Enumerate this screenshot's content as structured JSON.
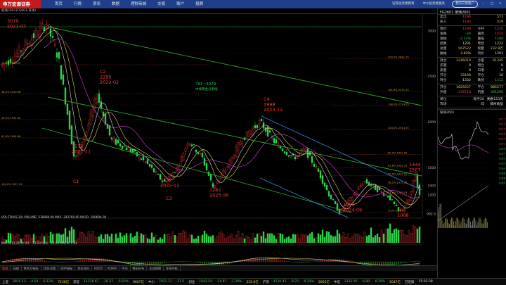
{
  "app": {
    "logo": "申万宏源证券",
    "menu": [
      "首页",
      "行情",
      "资讯",
      "数据",
      "理财商城",
      "交易",
      "账户",
      "投顾"
    ],
    "top_links": [
      "证券投资者教育",
      "中小投资者服务"
    ],
    "login_button": "我的交易账户"
  },
  "symbol_bar": "玻璃2601(FG601,日线)",
  "chart_data": {
    "type": "candlestick",
    "main_annotations": [
      {
        "text": "3079",
        "text2": "2021-07",
        "price": 3079
      },
      {
        "text": "C2",
        "text2": "2295",
        "text3": "2022-02",
        "price": 2295
      },
      {
        "text": "1572",
        "text2": "2021-11",
        "text3": "C1",
        "price": 1572
      },
      {
        "text": "1332",
        "text2": "2022-11",
        "text3": "C3",
        "price": 1332
      },
      {
        "text": "1282",
        "text2": "2023-06",
        "price": 1282
      },
      {
        "text": "C4",
        "text2": "1998",
        "text3": "2023-12",
        "price": 1998
      },
      {
        "text": "1004",
        "text2": "2024-09",
        "price": 1004
      },
      {
        "text": "1008",
        "price": 1008
      },
      {
        "text": "1444",
        "text2": "2507",
        "price": 1444
      }
    ],
    "channel_label": [
      "791~3079",
      "中线黄金分割线"
    ],
    "fib_levels": [
      {
        "label": "200.0%  2691.75",
        "price": 2691.75
      },
      {
        "label": "161.8%  2331.15",
        "price": 2331.15
      },
      {
        "label": "138.2%  2174.55",
        "price": 2174.55
      },
      {
        "label": "100.0%  1913.74",
        "price": 1913.74
      },
      {
        "label": "80.9%  1641.55",
        "price": 1641.55
      },
      {
        "label": "61.8%  1502.15",
        "price": 1502.15
      },
      {
        "label": "50.0%  1410.50",
        "price": 1410.5
      },
      {
        "label": "38.2%  1317.35",
        "price": 1317.35
      },
      {
        "label": "23.6%  1203.03",
        "price": 1203.03
      },
      {
        "label": "0.0%  1008.00",
        "price": 1008
      }
    ],
    "left_fib_levels": [
      "23.6%  2530.02",
      "38.2%  2250.98",
      "50.0%  1931.65",
      "61.8%  1844.46",
      "100.0%  1227.34"
    ],
    "price_axis": [
      "3000",
      "2500",
      "2000",
      "1500",
      "1300",
      "1200",
      "992.5"
    ],
    "volume_label": "VOL-TDX(5,10) VOLUME: 518480.00  MA5: 343760.00  MA10: 360694.00",
    "macd_label": "MACD(12,26,9) DIF: -13.93  DEA: -16.24  MACD: 4.62"
  },
  "sub_tabs": [
    "管理",
    "冠理",
    "MACD指标",
    "DDE决策",
    "BOP指标",
    "资金流向",
    "RSI55",
    "KDWR",
    "平均",
    "筹码分布",
    "全部周期",
    "年线中轨"
  ],
  "quote_panel": {
    "title": "FG2601 玻璃2601",
    "rows1": [
      {
        "l": "卖出",
        "v1": "1196",
        "v1c": "red",
        "l2": "",
        "v2": "571",
        "v2c": "yellow"
      },
      {
        "l": "买入",
        "v1": "1195",
        "v1c": "red",
        "l2": "",
        "v2": "519",
        "v2c": "yellow"
      }
    ],
    "rows2": [
      {
        "l": "现价",
        "v1": "1196",
        "v1c": "red",
        "l2": "今开",
        "v2": "1220",
        "v2c": "red"
      },
      {
        "l": "涨跌",
        "v1": "-26",
        "v1c": "green",
        "l2": "最高",
        "v2": "1224",
        "v2c": "red"
      },
      {
        "l": "涨幅",
        "v1": "-2.13%",
        "v1c": "green",
        "l2": "最低",
        "v2": "1184",
        "v2c": "green"
      },
      {
        "l": "结算",
        "v1": "1201",
        "v1c": "white",
        "l2": "昨结",
        "v2": "1222",
        "v2c": "white"
      },
      {
        "l": "总量",
        "v1": "567522",
        "v1c": "yellow",
        "l2": "现量",
        "v2": "232.9万",
        "v2c": "yellow"
      },
      {
        "l": "振幅",
        "v1": "3.03%",
        "v1c": "white",
        "l2": "均价",
        "v2": "1201",
        "v2c": "white"
      }
    ],
    "rows3": [
      {
        "l": "持仓",
        "v1": "2246019",
        "v1c": "yellow",
        "l2": "仓差",
        "v2": "61345",
        "v2c": "yellow"
      },
      {
        "l": "买量",
        "v1": "0",
        "v1c": "white",
        "l2": "增仓",
        "v2": "0",
        "v2c": "white"
      },
      {
        "l": "卖量",
        "v1": "0",
        "v1c": "white",
        "l2": "日增",
        "v2": "0",
        "v2c": "white"
      },
      {
        "l": "开仓",
        "v1": "33168",
        "v1c": "yellow",
        "l2": "平仓",
        "v2": "28",
        "v2c": "yellow"
      },
      {
        "l": "持仓",
        "v1": "1332",
        "v1c": "white",
        "l2": "跌停",
        "v2": "1112",
        "v2c": "green"
      }
    ],
    "rows4": [
      {
        "l": "开仓",
        "v1": "1829257",
        "v1c": "yellow",
        "l2": "平仓",
        "v2": "885577",
        "v2c": "yellow"
      },
      {
        "l": "外盘",
        "v1": "476718",
        "v1c": "red",
        "l2": "内盘",
        "v2": "491296",
        "v2c": "green"
      }
    ],
    "rows5": [
      {
        "l": "单位",
        "v1": "",
        "v1c": "white",
        "l2": "每手20吨",
        "v2": "剩余153天",
        "v2c": "white"
      },
      {
        "l": "市场",
        "v1": "",
        "v1c": "white",
        "l2": "",
        "v2": "郑州商品",
        "v2c": "white"
      }
    ],
    "mini_title": "玻璃2601",
    "mini_axis": [
      "1217",
      "1213",
      "1210",
      "1206",
      "1203",
      "1201",
      "1199",
      "1197",
      "1195",
      "1193",
      "1190",
      "1188",
      "1186",
      "1185"
    ]
  },
  "status_bar": [
    {
      "t": "上证",
      "c": "white"
    },
    {
      "t": "3835.13",
      "c": "green"
    },
    {
      "t": "-4.54",
      "c": "green"
    },
    {
      "t": "-0.12%",
      "c": "green"
    },
    {
      "t": "7136亿",
      "c": "yellow"
    },
    {
      "t": "深证",
      "c": "white"
    },
    {
      "t": "11128.67",
      "c": "green"
    },
    {
      "t": "-26.27",
      "c": "green"
    },
    {
      "t": "-0.20%",
      "c": "green"
    },
    {
      "t": "9607亿",
      "c": "yellow"
    },
    {
      "t": "中小",
      "c": "white"
    },
    {
      "t": "7021.11",
      "c": "green"
    },
    {
      "t": "-17.5",
      "c": "green"
    },
    {
      "t": "创业",
      "c": "white"
    },
    {
      "t": "1043.54",
      "c": "green"
    },
    {
      "t": "-14.87",
      "c": "green"
    },
    {
      "t": "-1.39%",
      "c": "green"
    },
    {
      "t": "333.8亿",
      "c": "yellow"
    },
    {
      "t": "沪深",
      "c": "white"
    },
    {
      "t": "4110.41",
      "c": "green"
    },
    {
      "t": "-9.70",
      "c": "green"
    },
    {
      "t": "-0.24%",
      "c": "green"
    },
    {
      "t": "3065亿",
      "c": "yellow"
    },
    {
      "t": "中证",
      "c": "white"
    },
    {
      "t": "2333.90",
      "c": "green"
    },
    {
      "t": "-6.89",
      "c": "green"
    },
    {
      "t": "-0.29%",
      "c": "green"
    },
    {
      "t": "5047亿",
      "c": "yellow"
    },
    {
      "t": "已连接",
      "c": "white"
    },
    {
      "t": "15:02:38",
      "c": "white"
    }
  ]
}
